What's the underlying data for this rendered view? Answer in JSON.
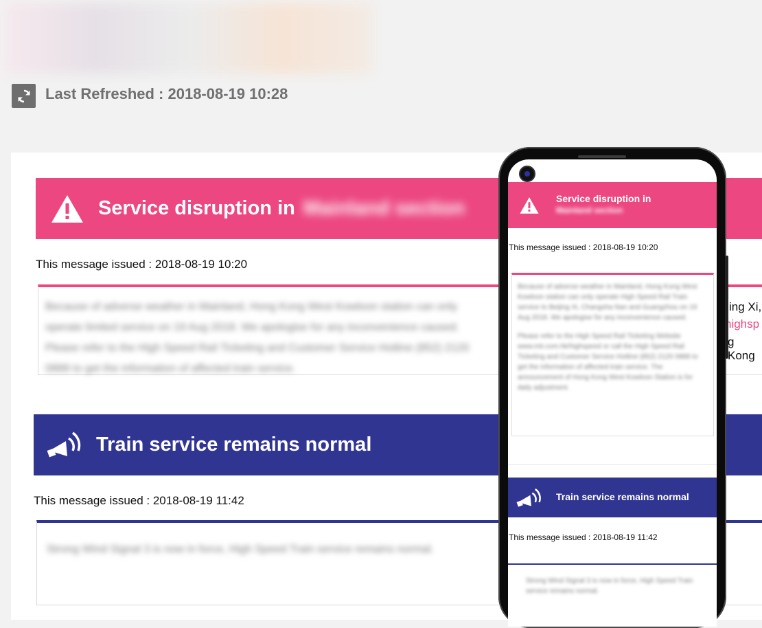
{
  "header": {
    "refresh_label": "Last Refreshed : 2018-08-19 10:28"
  },
  "messages": [
    {
      "title": "Service disruption in",
      "title_blurred": "Mainland section",
      "issued": "This message issued : 2018-08-19 10:20",
      "body_blurred": "Because of adverse weather in Mainland, Hong Kong West Kowloon station can only operate limited service on 19 Aug 2018. We apologise for any inconvenience caused. Please refer to the High Speed Rail Ticketing and Customer Service Hotline (852) 2120 0888 to get the information of affected train service.",
      "peek_lines": [
        "ing Xi,",
        "highsp",
        "g Kong"
      ],
      "color": "#ec4780",
      "icon": "warning-triangle-icon"
    },
    {
      "title": "Train service remains normal",
      "issued": "This message issued : 2018-08-19 11:42",
      "body_blurred": "Strong Wind Signal 3 is now in force, High Speed Train service remains normal.",
      "color": "#313592",
      "icon": "megaphone-icon"
    }
  ],
  "phone": {
    "msg1_title": "Service disruption in",
    "msg1_title_blurred": "Mainland section",
    "msg1_issued": "This message issued : 2018-08-19 10:20",
    "msg1_body_blurred_a": "Because of adverse weather in Mainland, Hong Kong West Kowloon station can only operate High Speed Rail Train service to Beijing Xi, Changsha Nan and Guangzhou on 19 Aug 2018. We apologise for any inconvenience caused.",
    "msg1_body_blurred_b": "Please refer to the High Speed Rail Ticketing Website www.mtr.com.hk/highspeed or call the High Speed Rail Ticketing and Customer Service Hotline (852) 2120 0888 to get the information of affected train service. The announcement of Hong Kong West Kowloon Station is for daily adjustment.",
    "msg2_title": "Train service remains normal",
    "msg2_issued": "This message issued : 2018-08-19 11:42",
    "msg2_body_blurred": "Strong Wind Signal 3 is now in force, High Speed Train service remains normal."
  }
}
